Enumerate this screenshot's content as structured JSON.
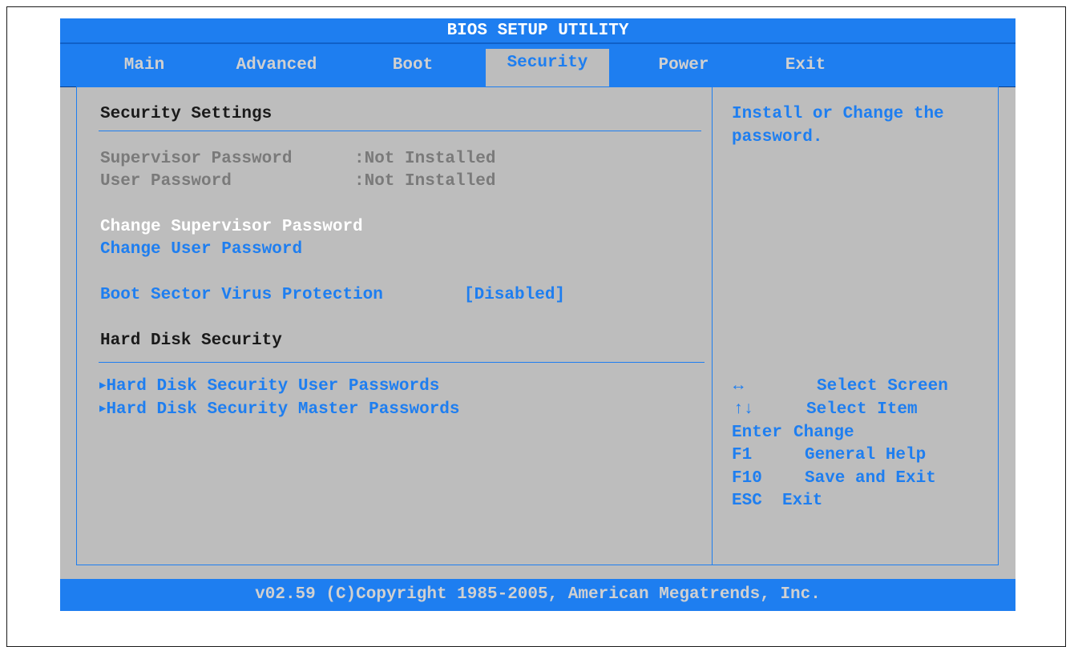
{
  "title": "BIOS SETUP UTILITY",
  "tabs": [
    {
      "label": "Main"
    },
    {
      "label": "Advanced"
    },
    {
      "label": "Boot"
    },
    {
      "label": "Security",
      "active": true
    },
    {
      "label": "Power"
    },
    {
      "label": "Exit"
    }
  ],
  "main": {
    "security_settings_heading": "Security Settings",
    "supervisor_password": {
      "label": "Supervisor Password",
      "value": ":Not Installed"
    },
    "user_password": {
      "label": "User Password",
      "value": ":Not Installed"
    },
    "change_supervisor_password": "Change Supervisor Password",
    "change_user_password": "Change User Password",
    "boot_sector_virus_protection": {
      "label": "Boot Sector Virus Protection",
      "value": "[Disabled]"
    },
    "hard_disk_security_heading": "Hard Disk Security",
    "hdd_user_passwords": "Hard Disk Security User Passwords",
    "hdd_master_passwords": "Hard Disk Security Master Passwords"
  },
  "help": {
    "text_line1": "Install or Change the",
    "text_line2": "password.",
    "keys": [
      {
        "key": "↔",
        "action": "Select Screen"
      },
      {
        "key": "↑↓",
        "action": "Select Item"
      },
      {
        "key": "Enter",
        "action": "Change"
      },
      {
        "key": "F1",
        "action": "General Help"
      },
      {
        "key": "F10",
        "action": "Save and Exit"
      },
      {
        "key": "ESC",
        "action": "Exit"
      }
    ]
  },
  "footer": "v02.59 (C)Copyright 1985-2005, American Megatrends, Inc.",
  "colors": {
    "accent": "#1e7ef0",
    "background": "#bdbdbd",
    "selected": "#ffffff"
  }
}
